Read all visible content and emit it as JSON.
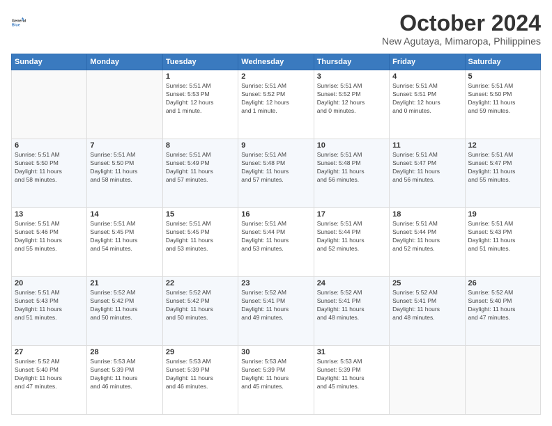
{
  "header": {
    "logo_line1": "General",
    "logo_line2": "Blue",
    "title": "October 2024",
    "subtitle": "New Agutaya, Mimaropa, Philippines"
  },
  "calendar": {
    "days_of_week": [
      "Sunday",
      "Monday",
      "Tuesday",
      "Wednesday",
      "Thursday",
      "Friday",
      "Saturday"
    ],
    "weeks": [
      [
        {
          "day": "",
          "info": ""
        },
        {
          "day": "",
          "info": ""
        },
        {
          "day": "1",
          "info": "Sunrise: 5:51 AM\nSunset: 5:53 PM\nDaylight: 12 hours\nand 1 minute."
        },
        {
          "day": "2",
          "info": "Sunrise: 5:51 AM\nSunset: 5:52 PM\nDaylight: 12 hours\nand 1 minute."
        },
        {
          "day": "3",
          "info": "Sunrise: 5:51 AM\nSunset: 5:52 PM\nDaylight: 12 hours\nand 0 minutes."
        },
        {
          "day": "4",
          "info": "Sunrise: 5:51 AM\nSunset: 5:51 PM\nDaylight: 12 hours\nand 0 minutes."
        },
        {
          "day": "5",
          "info": "Sunrise: 5:51 AM\nSunset: 5:50 PM\nDaylight: 11 hours\nand 59 minutes."
        }
      ],
      [
        {
          "day": "6",
          "info": "Sunrise: 5:51 AM\nSunset: 5:50 PM\nDaylight: 11 hours\nand 58 minutes."
        },
        {
          "day": "7",
          "info": "Sunrise: 5:51 AM\nSunset: 5:50 PM\nDaylight: 11 hours\nand 58 minutes."
        },
        {
          "day": "8",
          "info": "Sunrise: 5:51 AM\nSunset: 5:49 PM\nDaylight: 11 hours\nand 57 minutes."
        },
        {
          "day": "9",
          "info": "Sunrise: 5:51 AM\nSunset: 5:48 PM\nDaylight: 11 hours\nand 57 minutes."
        },
        {
          "day": "10",
          "info": "Sunrise: 5:51 AM\nSunset: 5:48 PM\nDaylight: 11 hours\nand 56 minutes."
        },
        {
          "day": "11",
          "info": "Sunrise: 5:51 AM\nSunset: 5:47 PM\nDaylight: 11 hours\nand 56 minutes."
        },
        {
          "day": "12",
          "info": "Sunrise: 5:51 AM\nSunset: 5:47 PM\nDaylight: 11 hours\nand 55 minutes."
        }
      ],
      [
        {
          "day": "13",
          "info": "Sunrise: 5:51 AM\nSunset: 5:46 PM\nDaylight: 11 hours\nand 55 minutes."
        },
        {
          "day": "14",
          "info": "Sunrise: 5:51 AM\nSunset: 5:45 PM\nDaylight: 11 hours\nand 54 minutes."
        },
        {
          "day": "15",
          "info": "Sunrise: 5:51 AM\nSunset: 5:45 PM\nDaylight: 11 hours\nand 53 minutes."
        },
        {
          "day": "16",
          "info": "Sunrise: 5:51 AM\nSunset: 5:44 PM\nDaylight: 11 hours\nand 53 minutes."
        },
        {
          "day": "17",
          "info": "Sunrise: 5:51 AM\nSunset: 5:44 PM\nDaylight: 11 hours\nand 52 minutes."
        },
        {
          "day": "18",
          "info": "Sunrise: 5:51 AM\nSunset: 5:44 PM\nDaylight: 11 hours\nand 52 minutes."
        },
        {
          "day": "19",
          "info": "Sunrise: 5:51 AM\nSunset: 5:43 PM\nDaylight: 11 hours\nand 51 minutes."
        }
      ],
      [
        {
          "day": "20",
          "info": "Sunrise: 5:51 AM\nSunset: 5:43 PM\nDaylight: 11 hours\nand 51 minutes."
        },
        {
          "day": "21",
          "info": "Sunrise: 5:52 AM\nSunset: 5:42 PM\nDaylight: 11 hours\nand 50 minutes."
        },
        {
          "day": "22",
          "info": "Sunrise: 5:52 AM\nSunset: 5:42 PM\nDaylight: 11 hours\nand 50 minutes."
        },
        {
          "day": "23",
          "info": "Sunrise: 5:52 AM\nSunset: 5:41 PM\nDaylight: 11 hours\nand 49 minutes."
        },
        {
          "day": "24",
          "info": "Sunrise: 5:52 AM\nSunset: 5:41 PM\nDaylight: 11 hours\nand 48 minutes."
        },
        {
          "day": "25",
          "info": "Sunrise: 5:52 AM\nSunset: 5:41 PM\nDaylight: 11 hours\nand 48 minutes."
        },
        {
          "day": "26",
          "info": "Sunrise: 5:52 AM\nSunset: 5:40 PM\nDaylight: 11 hours\nand 47 minutes."
        }
      ],
      [
        {
          "day": "27",
          "info": "Sunrise: 5:52 AM\nSunset: 5:40 PM\nDaylight: 11 hours\nand 47 minutes."
        },
        {
          "day": "28",
          "info": "Sunrise: 5:53 AM\nSunset: 5:39 PM\nDaylight: 11 hours\nand 46 minutes."
        },
        {
          "day": "29",
          "info": "Sunrise: 5:53 AM\nSunset: 5:39 PM\nDaylight: 11 hours\nand 46 minutes."
        },
        {
          "day": "30",
          "info": "Sunrise: 5:53 AM\nSunset: 5:39 PM\nDaylight: 11 hours\nand 45 minutes."
        },
        {
          "day": "31",
          "info": "Sunrise: 5:53 AM\nSunset: 5:39 PM\nDaylight: 11 hours\nand 45 minutes."
        },
        {
          "day": "",
          "info": ""
        },
        {
          "day": "",
          "info": ""
        }
      ]
    ]
  }
}
